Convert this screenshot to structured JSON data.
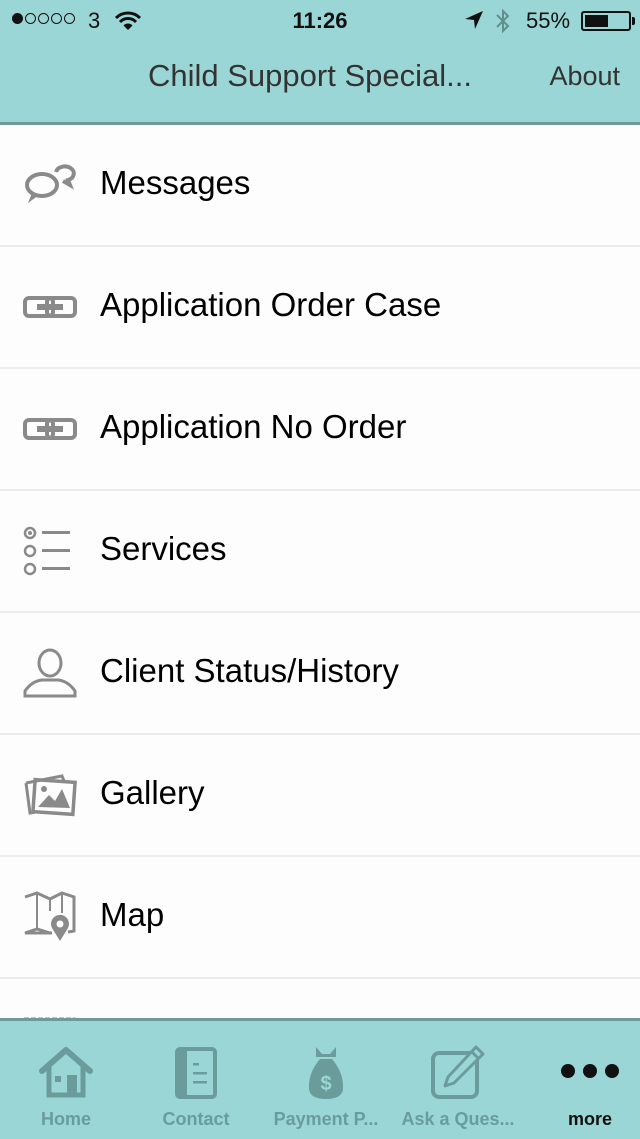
{
  "status_bar": {
    "signal_strength": "1 of 5",
    "carrier": "3",
    "time": "11:26",
    "battery_percent": "55%",
    "battery_level": 0.55,
    "icons": [
      "wifi-icon",
      "location-arrow-icon",
      "bluetooth-icon",
      "battery-icon"
    ]
  },
  "nav": {
    "title": "Child Support Special...",
    "about_label": "About"
  },
  "menu": {
    "items": [
      {
        "label": "Messages",
        "icon": "chat-bubbles-icon"
      },
      {
        "label": "Application Order Case",
        "icon": "link-icon"
      },
      {
        "label": "Application No Order",
        "icon": "link-icon"
      },
      {
        "label": "Services",
        "icon": "list-icon"
      },
      {
        "label": "Client Status/History",
        "icon": "user-icon"
      },
      {
        "label": "Gallery",
        "icon": "gallery-icon"
      },
      {
        "label": "Map",
        "icon": "map-icon"
      },
      {
        "label": "",
        "icon": "calendar-icon"
      }
    ]
  },
  "tabbar": {
    "tabs": [
      {
        "label": "Home",
        "icon": "home-icon"
      },
      {
        "label": "Contact",
        "icon": "contact-book-icon"
      },
      {
        "label": "Payment P...",
        "icon": "money-bag-icon"
      },
      {
        "label": "Ask a Ques...",
        "icon": "edit-pencil-icon"
      },
      {
        "label": "more",
        "icon": "more-dots-icon",
        "active": true
      }
    ]
  },
  "colors": {
    "header_bg": "#9bd6d6",
    "header_border": "#6e9a9a",
    "icon_gray": "#8a8a8a",
    "tab_inactive": "#6a9c9c",
    "tab_active": "#111111"
  }
}
